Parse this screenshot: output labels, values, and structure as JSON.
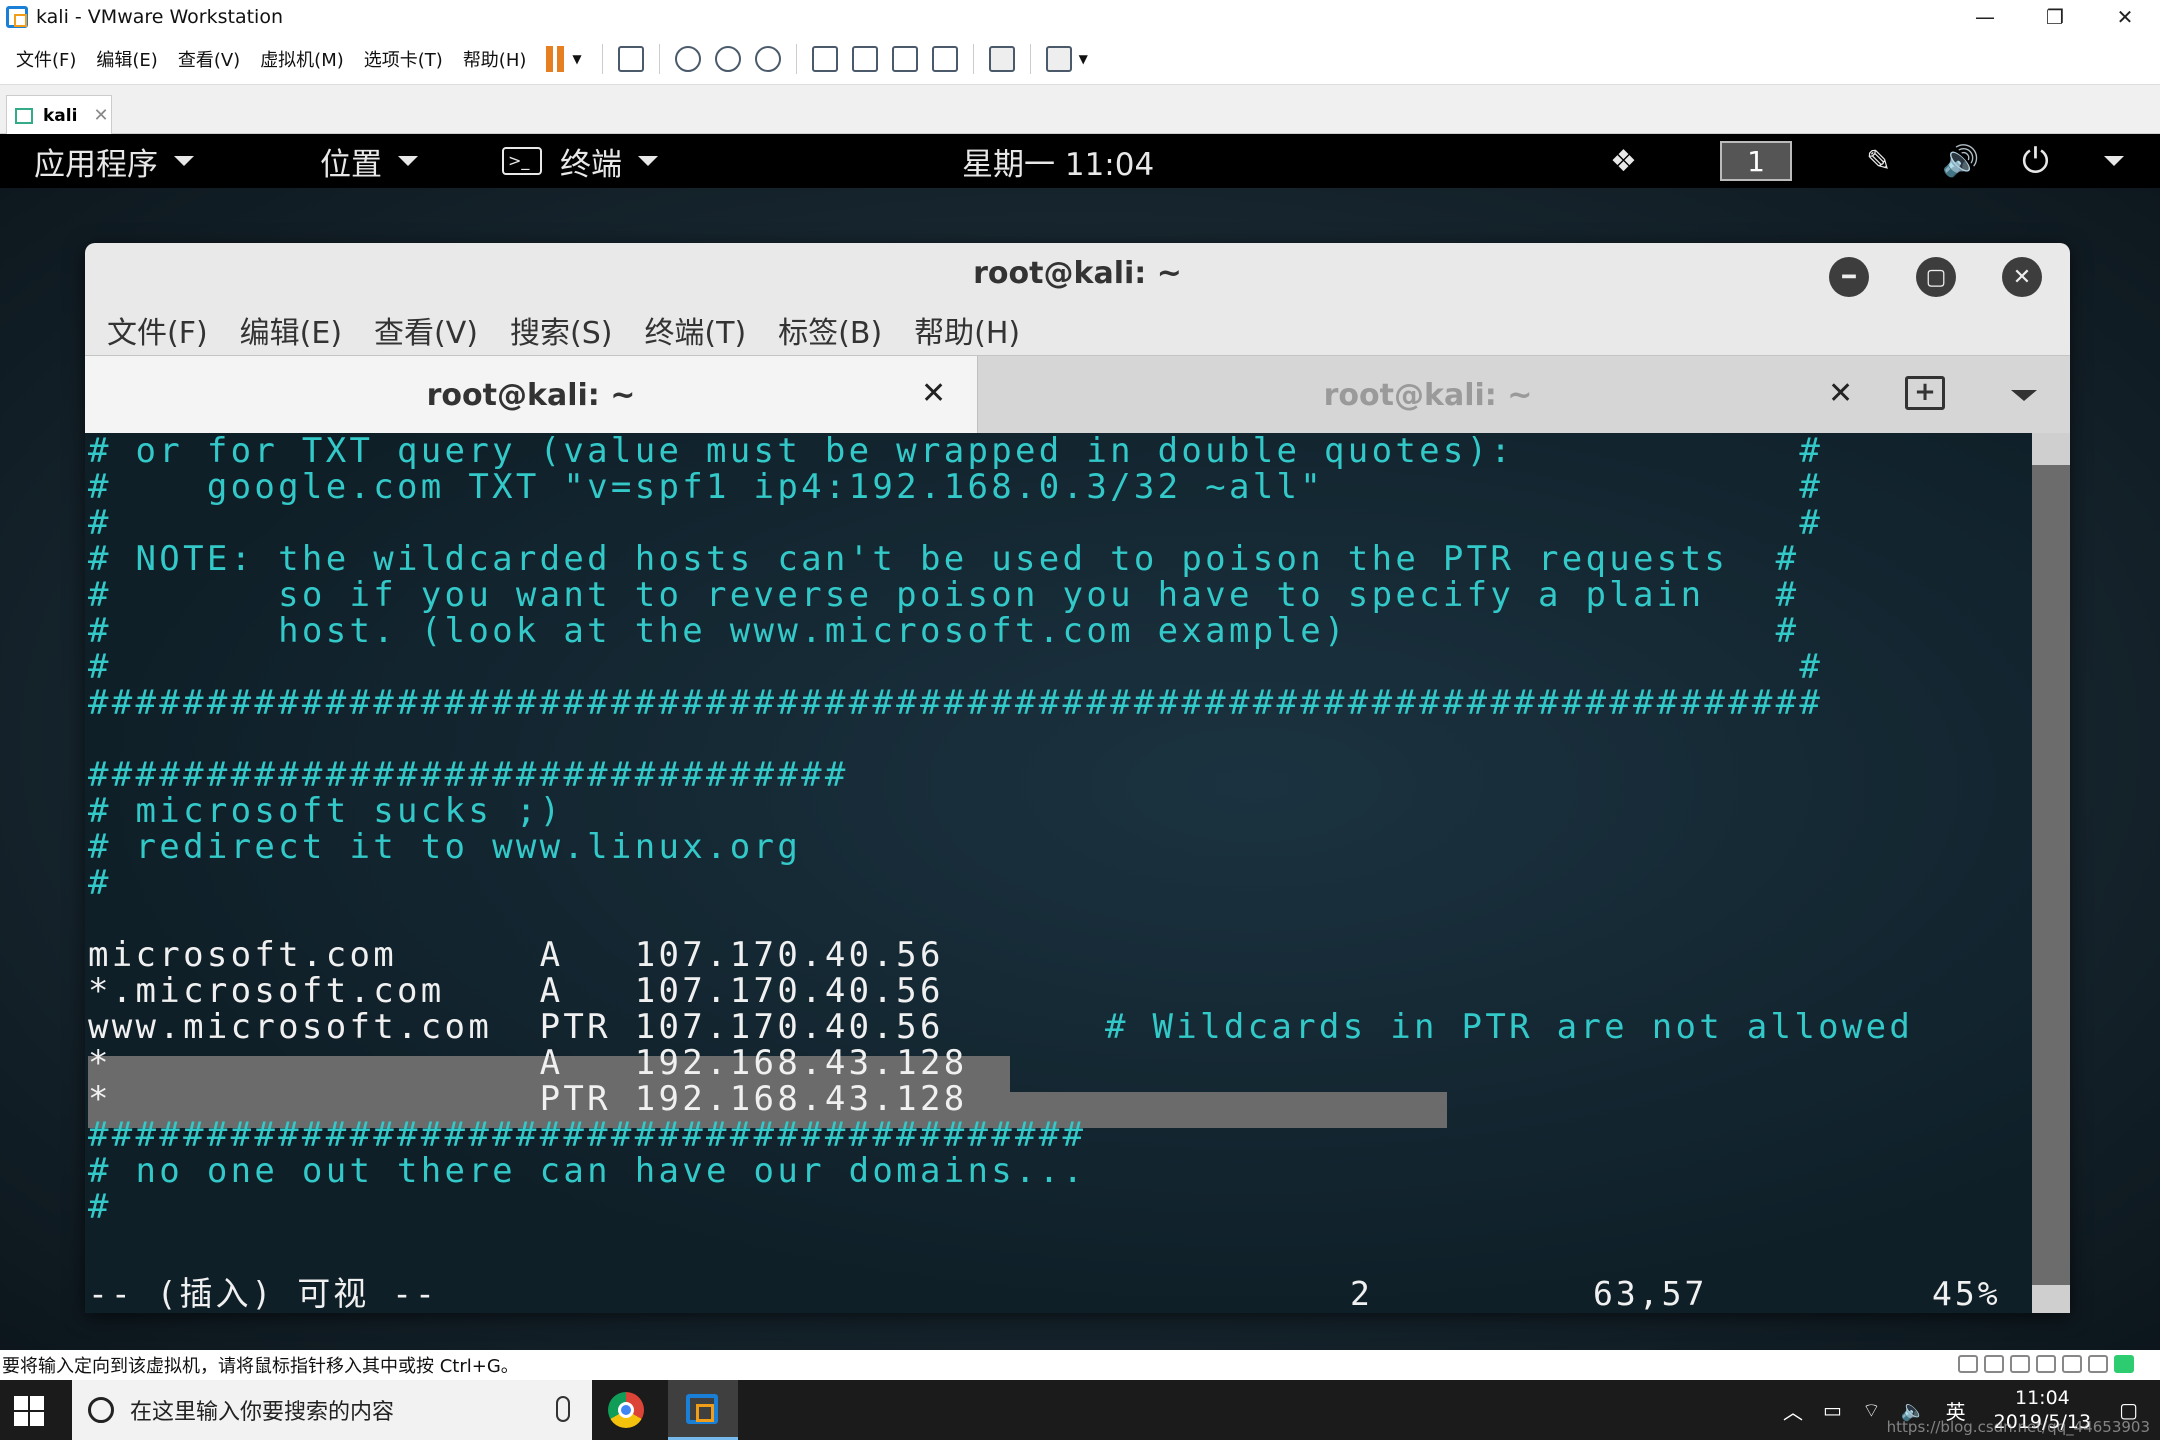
{
  "vmware": {
    "title": "kali - VMware Workstation",
    "menus": [
      "文件(F)",
      "编辑(E)",
      "查看(V)",
      "虚拟机(M)",
      "选项卡(T)",
      "帮助(H)"
    ],
    "tab_label": "kali",
    "status_text": "要将输入定向到该虚拟机，请将鼠标指针移入其中或按 Ctrl+G。"
  },
  "gnome": {
    "applications": "应用程序",
    "places": "位置",
    "terminal": "终端",
    "clock": "星期一 11:04",
    "workspace": "1"
  },
  "terminal": {
    "title": "root@kali: ~",
    "menus": [
      "文件(F)",
      "编辑(E)",
      "查看(V)",
      "搜索(S)",
      "终端(T)",
      "标签(B)",
      "帮助(H)"
    ],
    "tabs": [
      "root@kali: ~",
      "root@kali: ~"
    ],
    "lines": [
      {
        "text": "# or for TXT query (value must be wrapped in double quotes):            #",
        "color": "cyan"
      },
      {
        "text": "#    google.com TXT \"v=spf1 ip4:192.168.0.3/32 ~all\"                    #",
        "color": "cyan"
      },
      {
        "text": "#                                                                       #",
        "color": "cyan"
      },
      {
        "text": "# NOTE: the wildcarded hosts can't be used to poison the PTR requests  #",
        "color": "cyan"
      },
      {
        "text": "#       so if you want to reverse poison you have to specify a plain   #",
        "color": "cyan"
      },
      {
        "text": "#       host. (look at the www.microsoft.com example)                  #",
        "color": "cyan"
      },
      {
        "text": "#                                                                       #",
        "color": "cyan"
      },
      {
        "text": "#########################################################################",
        "color": "cyan"
      },
      {
        "text": "",
        "color": "cyan"
      },
      {
        "text": "################################",
        "color": "cyan"
      },
      {
        "text": "# microsoft sucks ;)",
        "color": "cyan"
      },
      {
        "text": "# redirect it to www.linux.org",
        "color": "cyan"
      },
      {
        "text": "#",
        "color": "cyan"
      },
      {
        "text": "",
        "color": "cyan"
      },
      {
        "text": "microsoft.com      A   107.170.40.56",
        "color": "white"
      },
      {
        "text": "*.microsoft.com    A   107.170.40.56",
        "color": "white"
      },
      {
        "text": "www.microsoft.com  PTR 107.170.40.56",
        "color": "white"
      },
      {
        "text": "*                  A   192.168.43.128",
        "color": "white"
      },
      {
        "text": "*                  PTR 192.168.43.128",
        "color": "white"
      },
      {
        "text": "##########################################",
        "color": "cyan"
      },
      {
        "text": "# no one out there can have our domains...",
        "color": "cyan"
      },
      {
        "text": "#",
        "color": "cyan"
      }
    ],
    "ptr_comment": "# Wildcards in PTR are not allowed",
    "status_mode": "-- (插入) 可视 --",
    "status_count": "2",
    "status_pos": "63,57",
    "status_pct": "45%"
  },
  "taskbar": {
    "search_placeholder": "在这里输入你要搜索的内容",
    "ime": "英",
    "time": "11:04",
    "date": "2019/5/13",
    "watermark": "https://blog.csdn.net/qq_44653903"
  }
}
